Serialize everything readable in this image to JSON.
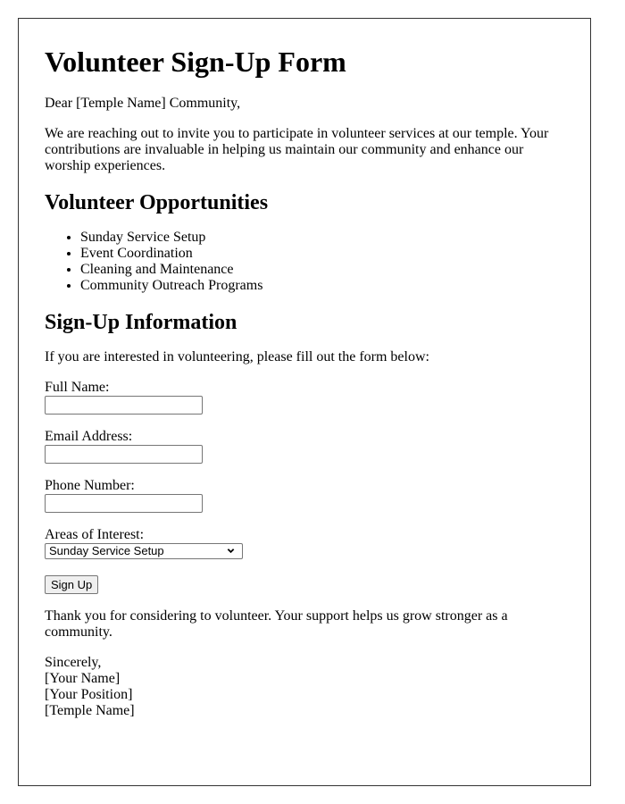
{
  "title": "Volunteer Sign-Up Form",
  "greeting": "Dear [Temple Name] Community,",
  "intro": "We are reaching out to invite you to participate in volunteer services at our temple. Your contributions are invaluable in helping us maintain our community and enhance our worship experiences.",
  "opportunities": {
    "heading": "Volunteer Opportunities",
    "items": [
      "Sunday Service Setup",
      "Event Coordination",
      "Cleaning and Maintenance",
      "Community Outreach Programs"
    ]
  },
  "signup": {
    "heading": "Sign-Up Information",
    "intro": "If you are interested in volunteering, please fill out the form below:",
    "fields": {
      "full_name": {
        "label": "Full Name:",
        "value": ""
      },
      "email": {
        "label": "Email Address:",
        "value": ""
      },
      "phone": {
        "label": "Phone Number:",
        "value": ""
      },
      "areas": {
        "label": "Areas of Interest:",
        "selected": "Sunday Service Setup"
      }
    },
    "submit_label": "Sign Up"
  },
  "closing": "Thank you for considering to volunteer. Your support helps us grow stronger as a community.",
  "signature": {
    "valediction": "Sincerely,",
    "name": "[Your Name]",
    "position": "[Your Position]",
    "organization": "[Temple Name]"
  },
  "colors": {
    "text": "#000000",
    "border": "#333333",
    "button_bg": "#efefef"
  }
}
